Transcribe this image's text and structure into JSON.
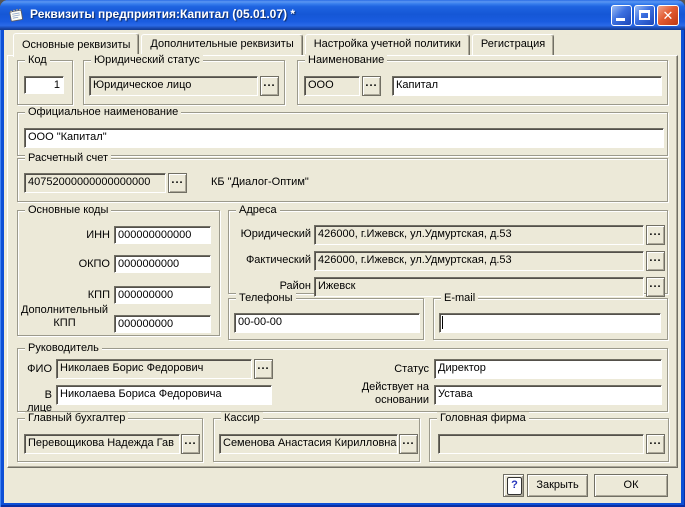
{
  "window": {
    "title": "Реквизиты предприятия:Капитал (05.01.07) *"
  },
  "tabs": [
    {
      "label": "Основные реквизиты",
      "active": true
    },
    {
      "label": "Дополнительные реквизиты",
      "active": false
    },
    {
      "label": "Настройка учетной политики",
      "active": false
    },
    {
      "label": "Регистрация",
      "active": false
    }
  ],
  "fields": {
    "code": {
      "label": "Код",
      "value": "1"
    },
    "legal_status": {
      "label": "Юридический статус",
      "value": "Юридическое лицо"
    },
    "name": {
      "label": "Наименование",
      "prefix": "ООО",
      "value": "Капитал"
    },
    "official_name": {
      "label": "Официальное наименование",
      "value": "ООО \"Капитал\""
    },
    "account": {
      "label": "Расчетный счет",
      "value": "40752000000000000000",
      "bank": "КБ \"Диалог-Оптим\""
    },
    "codes": {
      "label": "Основные коды",
      "rows": [
        {
          "label": "ИНН",
          "value": "000000000000"
        },
        {
          "label": "ОКПО",
          "value": "0000000000"
        },
        {
          "label": "КПП",
          "value": "000000000"
        },
        {
          "label": "Дополнительный КПП",
          "value": "000000000"
        }
      ]
    },
    "addresses": {
      "label": "Адреса",
      "rows": [
        {
          "label": "Юридический",
          "value": "426000, г.Ижевск, ул.Удмуртская, д.53"
        },
        {
          "label": "Фактический",
          "value": "426000, г.Ижевск, ул.Удмуртская, д.53"
        },
        {
          "label": "Район",
          "value": "Ижевск"
        }
      ]
    },
    "phones": {
      "label": "Телефоны",
      "value": "00-00-00"
    },
    "email": {
      "label": "E-mail",
      "value": ""
    },
    "manager": {
      "label": "Руководитель",
      "fio_label": "ФИО",
      "fio": "Николаев Борис Федорович",
      "person_label": "В лице",
      "person": "Николаева Бориса Федоровича",
      "status_label": "Статус",
      "status": "Директор",
      "basis_label": "Действует на основании",
      "basis": "Устава"
    },
    "chief_accountant": {
      "label": "Главный бухгалтер",
      "value": "Перевощикова Надежда Гав"
    },
    "cashier": {
      "label": "Кассир",
      "value": "Семенова Анастасия Кирилловна"
    },
    "head_firm": {
      "label": "Головная фирма",
      "value": ""
    }
  },
  "buttons": {
    "help_glyph": "?",
    "close_label": "Закрыть",
    "ok_label": "ОК"
  },
  "misc": {
    "ellipsis": "..."
  }
}
